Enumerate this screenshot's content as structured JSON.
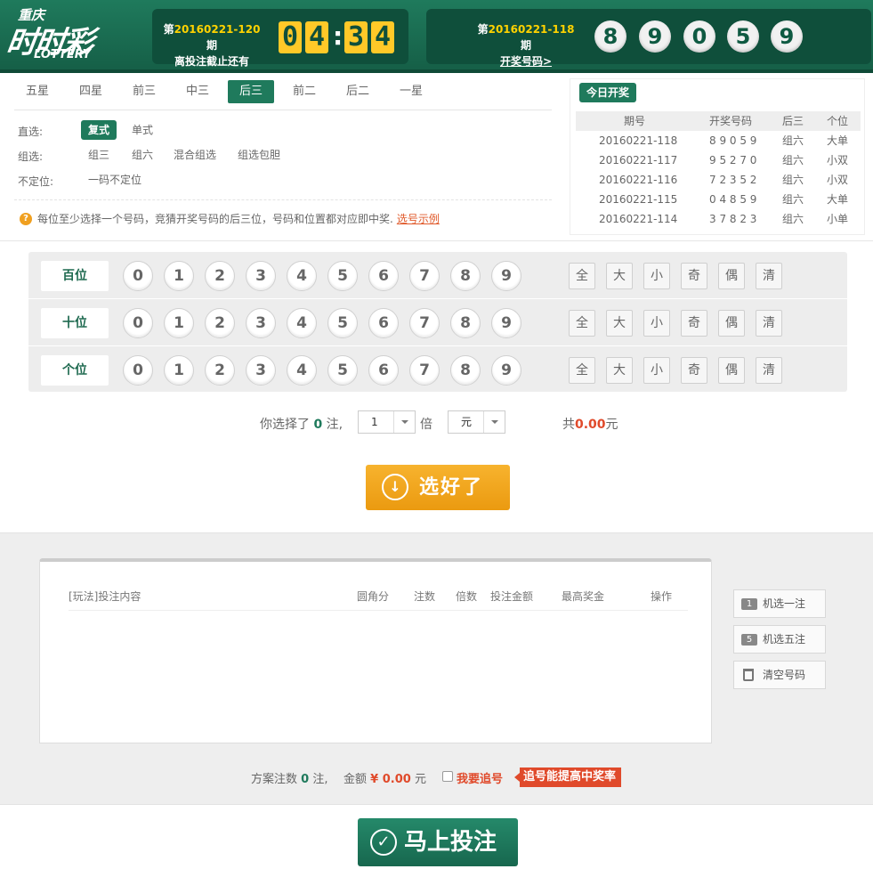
{
  "logo": {
    "top": "重庆",
    "main": "时时彩",
    "sub": "LOTTERY"
  },
  "current": {
    "prefix": "第",
    "issue": "20160221-120",
    "suffix": "期",
    "label": "离投注截止还有",
    "digits": [
      "0",
      "4",
      "3",
      "4"
    ],
    "colon": ":"
  },
  "last": {
    "prefix": "第",
    "issue": "20160221-118",
    "suffix": "期",
    "link": "开奖号码>",
    "balls": [
      "8",
      "9",
      "0",
      "5",
      "9"
    ]
  },
  "tabs": [
    "五星",
    "四星",
    "前三",
    "中三",
    "后三",
    "前二",
    "后二",
    "一星"
  ],
  "options": {
    "direct_label": "直选:",
    "direct": [
      "复式",
      "单式"
    ],
    "group_label": "组选:",
    "group": [
      "组三",
      "组六",
      "混合组选",
      "组选包胆"
    ],
    "nopos_label": "不定位:",
    "nopos": [
      "一码不定位"
    ]
  },
  "hint": {
    "icon": "?",
    "text": "每位至少选择一个号码，竞猜开奖号码的后三位，号码和位置都对应即中奖.",
    "link": "选号示例"
  },
  "today": {
    "button": "今日开奖",
    "headers": [
      "期号",
      "开奖号码",
      "后三",
      "个位"
    ],
    "rows": [
      [
        "20160221-118",
        "8 9 0 5 9",
        "组六",
        "大单"
      ],
      [
        "20160221-117",
        "9 5 2 7 0",
        "组六",
        "小双"
      ],
      [
        "20160221-116",
        "7 2 3 5 2",
        "组六",
        "小双"
      ],
      [
        "20160221-115",
        "0 4 8 5 9",
        "组六",
        "大单"
      ],
      [
        "20160221-114",
        "3 7 8 2 3",
        "组六",
        "小单"
      ]
    ]
  },
  "grid": {
    "rows": [
      "百位",
      "十位",
      "个位"
    ],
    "numbers": [
      "0",
      "1",
      "2",
      "3",
      "4",
      "5",
      "6",
      "7",
      "8",
      "9"
    ],
    "quick": [
      "全",
      "大",
      "小",
      "奇",
      "偶",
      "清"
    ]
  },
  "multiplier": {
    "pre": "你选择了",
    "count": "0",
    "unit": "注,",
    "times": "1",
    "times_label": "倍",
    "currency": "元",
    "total_pre": "共",
    "total": "0.00",
    "total_unit": "元"
  },
  "confirm": {
    "icon": "↓",
    "label": "选好了"
  },
  "order": {
    "headers": [
      "[玩法]投注内容",
      "圆角分",
      "注数",
      "倍数",
      "投注金额",
      "最高奖金",
      "操作"
    ]
  },
  "side": [
    {
      "badge": "1",
      "label": "机选一注"
    },
    {
      "badge": "5",
      "label": "机选五注"
    },
    {
      "badge": "",
      "label": "清空号码"
    }
  ],
  "summary": {
    "pre": "方案注数",
    "count": "0",
    "unit": "注,",
    "amount_label": "金额",
    "amount": "¥ 0.00",
    "amount_unit": "元",
    "chase": "我要追号",
    "tip": "追号能提高中奖率"
  },
  "bet": {
    "icon": "✓",
    "label": "马上投注"
  }
}
